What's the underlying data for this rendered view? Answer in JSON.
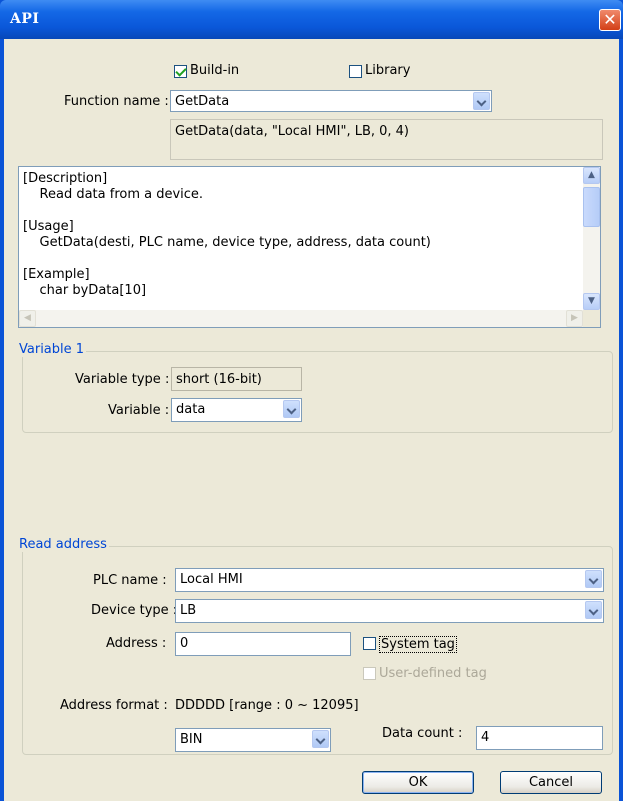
{
  "window": {
    "title": "API",
    "close_glyph": "✕"
  },
  "source": {
    "builtin_label": "Build-in",
    "builtin_checked": true,
    "library_label": "Library",
    "library_checked": false
  },
  "function": {
    "label": "Function name :",
    "value": "GetData",
    "preview": "GetData(data, \"Local HMI\", LB, 0, 4)"
  },
  "description_text": "[Description]\n    Read data from a device.\n\n[Usage]\n    GetData(desti, PLC name, device type, address, data count)\n\n[Example]\n    char byData[10]",
  "variable1": {
    "group_title": "Variable 1",
    "type_label": "Variable type :",
    "type_value": "short (16-bit)",
    "variable_label": "Variable :",
    "variable_value": "data"
  },
  "read_address": {
    "group_title": "Read address",
    "plc_label": "PLC name :",
    "plc_value": "Local HMI",
    "device_label": "Device type :",
    "device_value": "LB",
    "address_label": "Address :",
    "address_value": "0",
    "system_tag_label": "System tag",
    "system_tag_checked": false,
    "user_tag_label": "User-defined tag",
    "user_tag_checked": false,
    "format_label": "Address format :",
    "format_value": "DDDDD [range : 0 ~ 12095]",
    "format_select": "BIN",
    "count_label": "Data count :",
    "count_value": "4"
  },
  "buttons": {
    "ok": "OK",
    "cancel": "Cancel"
  }
}
